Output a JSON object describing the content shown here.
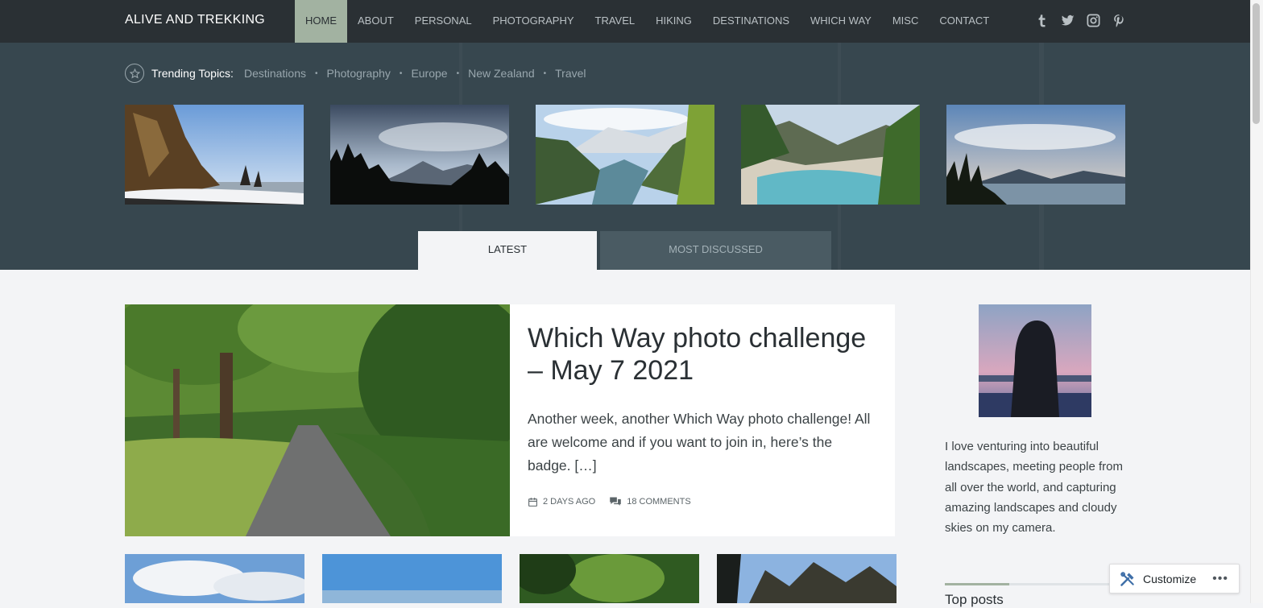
{
  "site": {
    "title": "ALIVE AND TREKKING"
  },
  "nav": {
    "items": [
      {
        "label": "HOME",
        "active": true
      },
      {
        "label": "ABOUT"
      },
      {
        "label": "PERSONAL"
      },
      {
        "label": "PHOTOGRAPHY"
      },
      {
        "label": "TRAVEL"
      },
      {
        "label": "HIKING"
      },
      {
        "label": "DESTINATIONS"
      },
      {
        "label": "WHICH WAY"
      },
      {
        "label": "MISC"
      },
      {
        "label": "CONTACT"
      }
    ]
  },
  "social": [
    "tumblr-icon",
    "twitter-icon",
    "instagram-icon",
    "pinterest-icon"
  ],
  "trending": {
    "label": "Trending Topics:",
    "topics": [
      "Destinations",
      "Photography",
      "Europe",
      "New Zealand",
      "Travel"
    ]
  },
  "tabs": {
    "latest": "LATEST",
    "discussed": "MOST DISCUSSED"
  },
  "featured": {
    "title": "Which Way photo challenge – May 7 2021",
    "excerpt": "Another week, another Which Way photo challenge! All are welcome and if you want to join in, here’s the badge. […]",
    "date": "2 DAYS AGO",
    "comments": "18 COMMENTS"
  },
  "sidebar": {
    "bio": "I love venturing into beautiful landscapes, meeting people from all over the world, and capturing amazing landscapes and cloudy skies on my camera.",
    "widget_title": "Top posts"
  },
  "customize": {
    "label": "Customize",
    "more": "•••"
  },
  "colors": {
    "topbar": "#2a3034",
    "hero": "#37474f",
    "accent": "#a2b2a1"
  }
}
